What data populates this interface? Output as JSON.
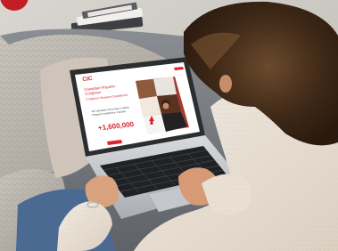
{
  "photo": {
    "subject": "person using laptop on couch",
    "accent_color": "#d8262c",
    "sweater_color": "#efe6db",
    "couch_color": "#7a7e84",
    "throw_color": "#b9b4ae"
  },
  "laptop_screen": {
    "logo_text": "CIC",
    "headline_line1": "Canadian Hispanic",
    "headline_line2": "Congress",
    "headline_line3": "Congreso Hispano-Canadiense",
    "body_line1": "We represent more than a million",
    "body_line2": "Hispanic residents in Canada",
    "big_number": "+1,600,000"
  }
}
